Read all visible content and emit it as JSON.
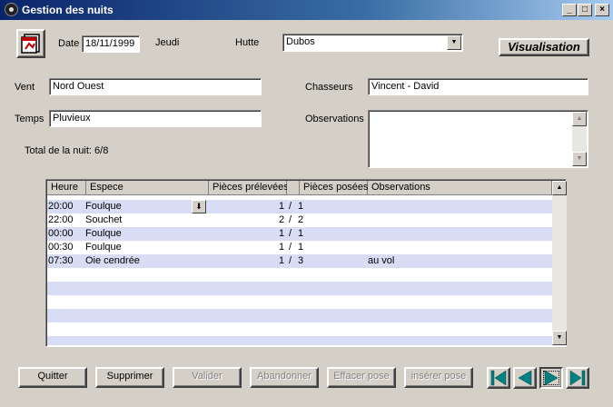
{
  "window": {
    "title": "Gestion des nuits",
    "minimize": "_",
    "maximize": "□",
    "close": "×"
  },
  "header": {
    "date_label": "Date",
    "date_value": "18/11/1999",
    "day": "Jeudi",
    "hutte_label": "Hutte",
    "hutte_value": "Dubos",
    "mode": "Visualisation"
  },
  "form": {
    "vent_label": "Vent",
    "vent_value": "Nord Ouest",
    "chasseurs_label": "Chasseurs",
    "chasseurs_value": "Vincent - David",
    "temps_label": "Temps",
    "temps_value": "Pluvieux",
    "observations_label": "Observations",
    "observations_value": "",
    "total": "Total de la nuit: 6/8"
  },
  "grid": {
    "headers": [
      "Heure",
      "Espece",
      "Pièces prélevées",
      "",
      "Pièces posées",
      "Observations"
    ],
    "rows": [
      {
        "heure": "20:00",
        "espece": "Foulque",
        "prelevees": "1",
        "sep": "/",
        "posees": "1",
        "obs": ""
      },
      {
        "heure": "22:00",
        "espece": "Souchet",
        "prelevees": "2",
        "sep": "/",
        "posees": "2",
        "obs": ""
      },
      {
        "heure": "00:00",
        "espece": "Foulque",
        "prelevees": "1",
        "sep": "/",
        "posees": "1",
        "obs": ""
      },
      {
        "heure": "00:30",
        "espece": "Foulque",
        "prelevees": "1",
        "sep": "/",
        "posees": "1",
        "obs": ""
      },
      {
        "heure": "07:30",
        "espece": "Oie cendrée",
        "prelevees": "1",
        "sep": "/",
        "posees": "3",
        "obs": "au vol"
      }
    ]
  },
  "buttons": {
    "quitter": "Quitter",
    "supprimer": "Supprimer",
    "valider": "Valider",
    "abandonner": "Abandonner",
    "effacer_pose": "Effacer pose",
    "inserer_pose": "insérer pose"
  },
  "icons": {
    "calendar": "calendar-icon",
    "first": "first-record-icon",
    "prev": "previous-record-icon",
    "next": "next-record-icon",
    "last": "last-record-icon"
  },
  "colors": {
    "titlebar_start": "#0a246a",
    "titlebar_end": "#a6caf0",
    "face": "#d4d0c8",
    "row_alt": "#d8dcf4",
    "nav_arrow": "#008080"
  }
}
